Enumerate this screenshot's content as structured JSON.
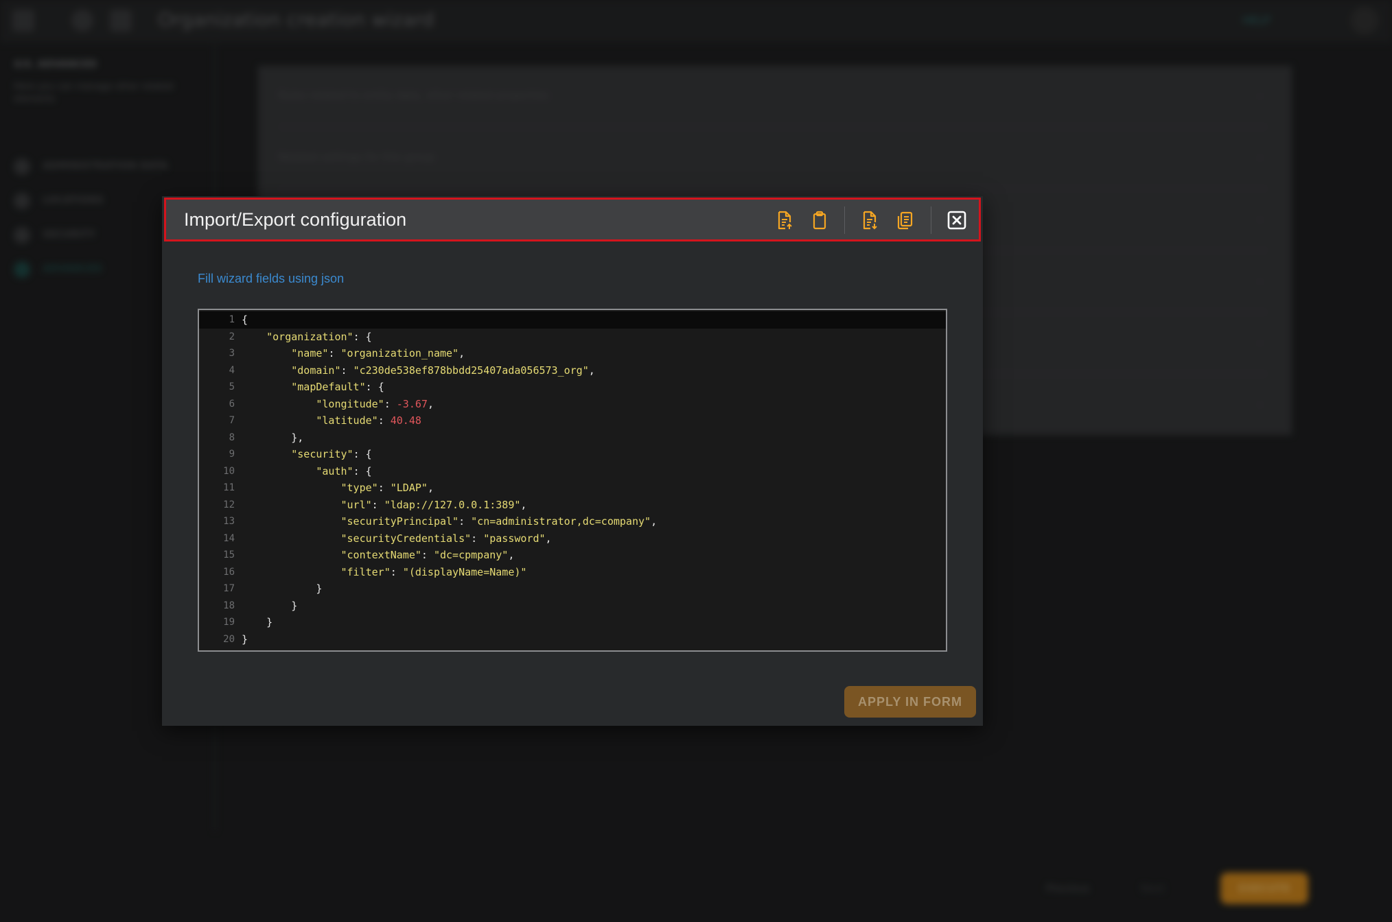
{
  "background": {
    "window_title": "Organization creation wizard",
    "help_label": "HELP",
    "step_label": "4/4. ADVANCED",
    "step_description": "Here you can manage other related elements",
    "sidebar_items": [
      {
        "label": "ADMINISTRATION DATA"
      },
      {
        "label": "LOCATIONS"
      },
      {
        "label": "SECURITY"
      },
      {
        "label": "ADVANCED"
      }
    ],
    "content_rows": [
      {
        "label": "Rules related to entity data, other related properties"
      },
      {
        "label": "Related settings for this group"
      },
      {
        "label": ""
      },
      {
        "label": ""
      },
      {
        "label": ""
      },
      {
        "label": ""
      }
    ],
    "previous_label": "Previous",
    "next_label": "Next",
    "execute_label": "EXECUTE"
  },
  "dialog": {
    "title": "Import/Export configuration",
    "subtitle": "Fill wizard fields using json",
    "icons": {
      "import_file": "file-import-icon",
      "paste": "clipboard-paste-icon",
      "export_file": "file-export-icon",
      "copy": "copy-icon",
      "close": "close-icon"
    },
    "apply_label": "APPLY IN FORM",
    "accent_color": "#f5a623",
    "header_outline_color": "#d4141d",
    "link_color": "#3b8ad0"
  },
  "editor": {
    "line_numbers": [
      "1",
      "2",
      "3",
      "4",
      "5",
      "6",
      "7",
      "8",
      "9",
      "10",
      "11",
      "12",
      "13",
      "14",
      "15",
      "16",
      "17",
      "18",
      "19",
      "20"
    ],
    "lines": [
      "{",
      "    \"organization\": {",
      "        \"name\": \"organization_name\",",
      "        \"domain\": \"c230de538ef878bbdd25407ada056573_org\",",
      "        \"mapDefault\": {",
      "            \"longitude\": -3.67,",
      "            \"latitude\": 40.48",
      "        },",
      "        \"security\": {",
      "            \"auth\": {",
      "                \"type\": \"LDAP\",",
      "                \"url\": \"ldap://127.0.0.1:389\",",
      "                \"securityPrincipal\": \"cn=administrator,dc=company\",",
      "                \"securityCredentials\": \"password\",",
      "                \"contextName\": \"dc=cpmpany\",",
      "                \"filter\": \"(displayName=Name)\"",
      "            }",
      "        }",
      "    }",
      "}"
    ]
  }
}
